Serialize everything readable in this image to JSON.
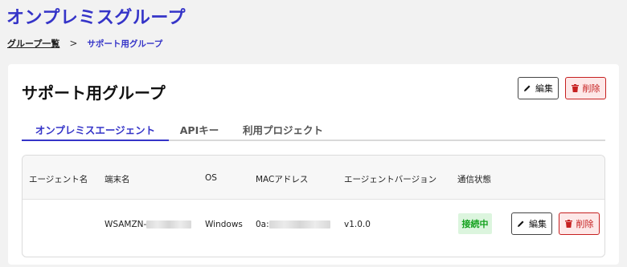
{
  "header": {
    "title": "オンプレミスグループ"
  },
  "breadcrumb": {
    "parent": "グループ一覧",
    "separator": ">",
    "current": "サポート用グループ"
  },
  "card": {
    "title": "サポート用グループ",
    "edit_label": "編集",
    "delete_label": "削除"
  },
  "tabs": [
    {
      "label": "オンプレミスエージェント",
      "active": true
    },
    {
      "label": "APIキー",
      "active": false
    },
    {
      "label": "利用プロジェクト",
      "active": false
    }
  ],
  "table": {
    "columns": [
      "エージェント名",
      "端末名",
      "OS",
      "MACアドレス",
      "エージェントバージョン",
      "通信状態"
    ],
    "rows": [
      {
        "agent_name": "",
        "hostname_prefix": "WSAMZN-",
        "os": "Windows",
        "mac_prefix": "0a:",
        "version": "v1.0.0",
        "status": "接続中",
        "edit_label": "編集",
        "delete_label": "削除"
      }
    ]
  },
  "colors": {
    "accent": "#3534c8",
    "danger": "#c62020",
    "success": "#15a21f"
  }
}
